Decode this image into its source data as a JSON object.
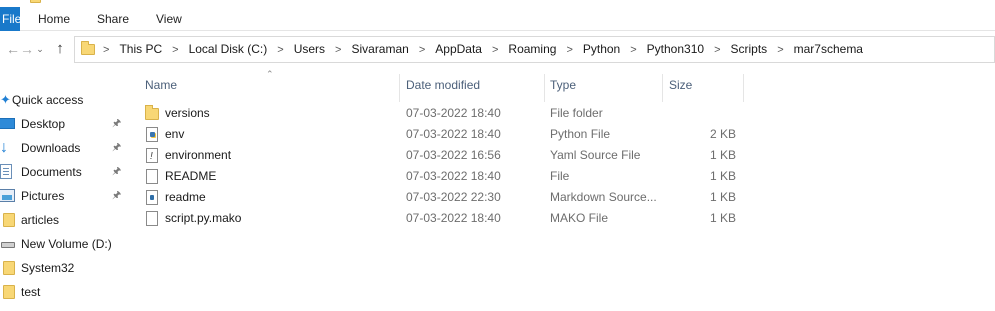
{
  "ribbon": {
    "file_tab": "File",
    "tabs": [
      "Home",
      "Share",
      "View"
    ]
  },
  "nav": {
    "back_icon": "back-arrow-icon",
    "forward_icon": "forward-arrow-icon",
    "recent_icon": "chevron-down-icon",
    "up_icon": "up-arrow-icon"
  },
  "address": {
    "crumbs": [
      "This PC",
      "Local Disk (C:)",
      "Users",
      "Sivaraman",
      "AppData",
      "Roaming",
      "Python",
      "Python310",
      "Scripts",
      "mar7schema"
    ]
  },
  "sidebar": {
    "quick_access": "Quick access",
    "items": [
      {
        "label": "Desktop",
        "icon": "desktop-icon",
        "pinned": true
      },
      {
        "label": "Downloads",
        "icon": "downloads-icon",
        "pinned": true
      },
      {
        "label": "Documents",
        "icon": "documents-icon",
        "pinned": true
      },
      {
        "label": "Pictures",
        "icon": "pictures-icon",
        "pinned": true
      },
      {
        "label": "articles",
        "icon": "folder-icon",
        "pinned": false
      },
      {
        "label": "New Volume (D:)",
        "icon": "drive-icon",
        "pinned": false
      },
      {
        "label": "System32",
        "icon": "folder-icon",
        "pinned": false
      },
      {
        "label": "test",
        "icon": "folder-icon",
        "pinned": false
      }
    ]
  },
  "columns": {
    "name": "Name",
    "date": "Date modified",
    "type": "Type",
    "size": "Size"
  },
  "files": [
    {
      "name": "versions",
      "date": "07-03-2022 18:40",
      "type": "File folder",
      "size": "",
      "icon": "folder-icon"
    },
    {
      "name": "env",
      "date": "07-03-2022 18:40",
      "type": "Python File",
      "size": "2 KB",
      "icon": "python-file-icon"
    },
    {
      "name": "environment",
      "date": "07-03-2022 16:56",
      "type": "Yaml Source File",
      "size": "1 KB",
      "icon": "yaml-file-icon"
    },
    {
      "name": "README",
      "date": "07-03-2022 18:40",
      "type": "File",
      "size": "1 KB",
      "icon": "file-icon"
    },
    {
      "name": "readme",
      "date": "07-03-2022 22:30",
      "type": "Markdown Source...",
      "size": "1 KB",
      "icon": "markdown-file-icon"
    },
    {
      "name": "script.py.mako",
      "date": "07-03-2022 18:40",
      "type": "MAKO File",
      "size": "1 KB",
      "icon": "file-icon"
    }
  ],
  "colors": {
    "accent": "#1979ca",
    "folder": "#f8d775",
    "header_text": "#4c607a"
  }
}
